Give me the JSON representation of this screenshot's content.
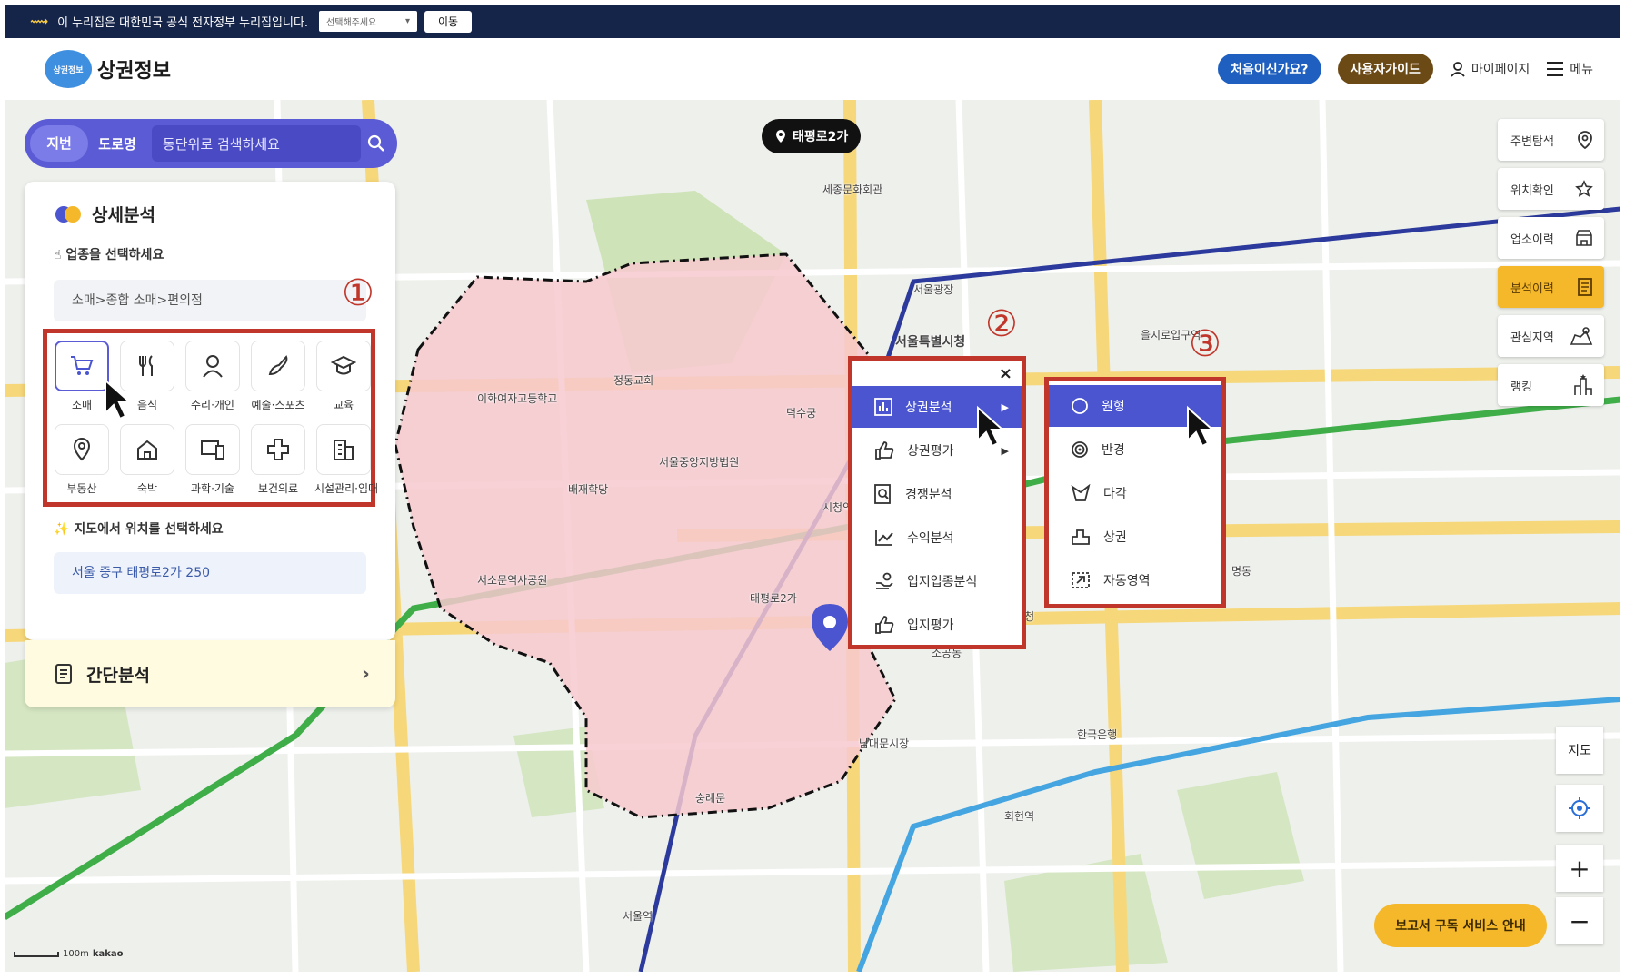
{
  "gov_bar": {
    "text": "이 누리집은 대한민국 공식 전자정부 누리집입니다.",
    "select_placeholder": "선택해주세요",
    "go_button": "이동"
  },
  "header": {
    "logo_badge": "상권정보",
    "app_name": "상권정보",
    "first_time_button": "처음이신가요?",
    "user_guide_button": "사용자가이드",
    "mypage": "마이페이지",
    "menu": "메뉴"
  },
  "search": {
    "tab_lot": "지번",
    "tab_road": "도로명",
    "placeholder": "동단위로 검색하세요"
  },
  "panel": {
    "title": "상세분석",
    "choose_industry": "업종을 선택하세요",
    "industry_path": "소매>종합 소매>편의점",
    "categories": [
      {
        "label": "소매",
        "icon": "cart-icon",
        "selected": true
      },
      {
        "label": "음식",
        "icon": "fork-knife-icon"
      },
      {
        "label": "수리·개인",
        "icon": "person-icon"
      },
      {
        "label": "예술·스포츠",
        "icon": "brush-icon"
      },
      {
        "label": "교육",
        "icon": "graduation-cap-icon"
      },
      {
        "label": "부동산",
        "icon": "map-pin-icon"
      },
      {
        "label": "숙박",
        "icon": "house-icon"
      },
      {
        "label": "과학·기술",
        "icon": "device-icon"
      },
      {
        "label": "보건의료",
        "icon": "medical-cross-icon"
      },
      {
        "label": "시설관리·임대",
        "icon": "building-icon"
      }
    ],
    "choose_location": "지도에서 위치를 선택하세요",
    "address": "서울 중구 태평로2가 250",
    "simple_analysis": "간단분석"
  },
  "map": {
    "pin_label": "태평로2가",
    "labels": [
      {
        "text": "서울특별시청"
      },
      {
        "text": "덕수궁"
      },
      {
        "text": "시청역"
      },
      {
        "text": "서울광장"
      },
      {
        "text": "숭례문"
      },
      {
        "text": "남대문시장"
      },
      {
        "text": "서울역"
      },
      {
        "text": "세종문화회관"
      },
      {
        "text": "을지로입구역"
      },
      {
        "text": "명동"
      },
      {
        "text": "회현역"
      },
      {
        "text": "한국은행"
      },
      {
        "text": "정동교회"
      },
      {
        "text": "이화여자고등학교"
      },
      {
        "text": "배재학당"
      },
      {
        "text": "서울중앙지방법원"
      },
      {
        "text": "서소문역사공원"
      },
      {
        "text": "소공동"
      },
      {
        "text": "태평로2가"
      },
      {
        "text": "중구청"
      }
    ],
    "scale": "100m",
    "attribution": "kakao"
  },
  "menu1": {
    "items": [
      {
        "label": "상권분석",
        "icon": "bar-chart-icon",
        "active": true,
        "submenu": true
      },
      {
        "label": "상권평가",
        "icon": "thumbs-up-icon",
        "submenu": true
      },
      {
        "label": "경쟁분석",
        "icon": "magnifier-doc-icon"
      },
      {
        "label": "수익분석",
        "icon": "line-chart-icon"
      },
      {
        "label": "입지업종분석",
        "icon": "hand-coins-icon"
      },
      {
        "label": "입지평가",
        "icon": "thumbs-up-star-icon"
      }
    ]
  },
  "menu2": {
    "items": [
      {
        "label": "원형",
        "icon": "circle-icon",
        "active": true
      },
      {
        "label": "반경",
        "icon": "target-icon"
      },
      {
        "label": "다각",
        "icon": "polygon-icon"
      },
      {
        "label": "상권",
        "icon": "area-icon"
      },
      {
        "label": "자동영역",
        "icon": "auto-area-icon"
      }
    ]
  },
  "right_rail": [
    {
      "label": "주변탐색",
      "icon": "location-icon"
    },
    {
      "label": "위치확인",
      "icon": "star-icon"
    },
    {
      "label": "업소이력",
      "icon": "store-icon"
    },
    {
      "label": "분석이력",
      "icon": "document-icon",
      "active": true
    },
    {
      "label": "관심지역",
      "icon": "map-region-icon"
    },
    {
      "label": "랭킹",
      "icon": "ranking-icon"
    }
  ],
  "map_controls": {
    "map_type": "지도",
    "zoom_in": "+",
    "zoom_out": "−"
  },
  "report_button": "보고서 구독 서비스 안내",
  "annotations": [
    "①",
    "②",
    "③"
  ],
  "colors": {
    "primary": "#5b5bd6",
    "menu_active": "#4a55cf",
    "highlight_box": "#c0362b",
    "accent_yellow": "#f5b82a",
    "gov_bar": "#15254a",
    "area_fill": "#f7c9cf"
  }
}
